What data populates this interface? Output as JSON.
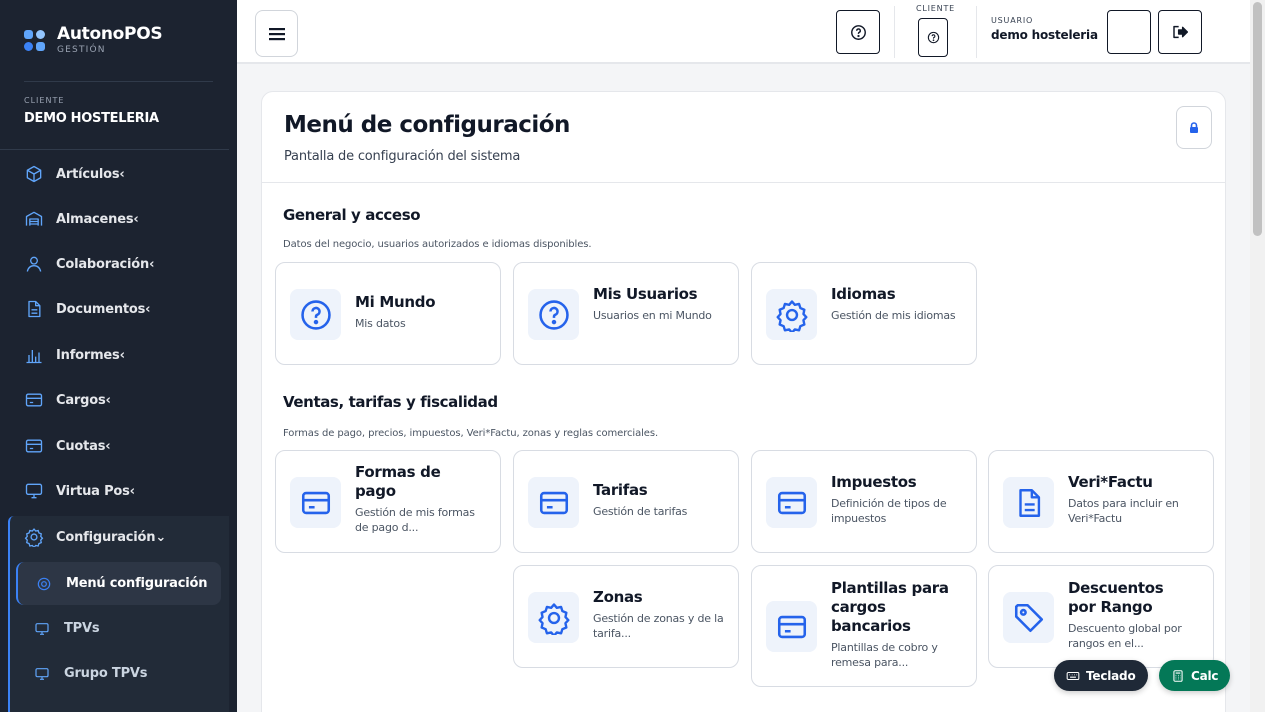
{
  "brand": {
    "name": "AutonoPOS",
    "subtitle": "GESTIÓN"
  },
  "client": {
    "label": "CLIENTE",
    "name": "DEMO HOSTELERIA"
  },
  "sidebar": {
    "items": [
      {
        "label": "Artículos‹",
        "icon": "cube-icon"
      },
      {
        "label": "Almacenes‹",
        "icon": "warehouse-icon"
      },
      {
        "label": "Colaboración‹",
        "icon": "user-icon"
      },
      {
        "label": "Documentos‹",
        "icon": "document-icon"
      },
      {
        "label": "Informes‹",
        "icon": "bar-chart-icon"
      },
      {
        "label": "Cargos‹",
        "icon": "card-icon"
      },
      {
        "label": "Cuotas‹",
        "icon": "card-icon"
      },
      {
        "label": "Virtua Pos‹",
        "icon": "monitor-icon"
      },
      {
        "label": "Configuración⌄",
        "icon": "gear-icon"
      }
    ],
    "submenu": [
      {
        "label": "Menú configuración",
        "icon": "gear-icon",
        "active": true
      },
      {
        "label": "TPVs",
        "icon": "monitor-icon"
      },
      {
        "label": "Grupo TPVs",
        "icon": "monitor-icon"
      }
    ]
  },
  "topbar": {
    "client_label": "CLIENTE",
    "user_label": "USUARIO",
    "user_name": "demo hosteleria"
  },
  "page": {
    "title": "Menú de configuración",
    "subtitle": "Pantalla de configuración del sistema"
  },
  "sections": [
    {
      "title": "General y acceso",
      "description": "Datos del negocio, usuarios autorizados e idiomas disponibles.",
      "tiles": [
        {
          "title": "Mi Mundo",
          "desc": "Mis datos",
          "icon": "question-circle-icon"
        },
        {
          "title": "Mis Usuarios",
          "desc": "Usuarios en mi Mundo",
          "icon": "question-circle-icon"
        },
        {
          "title": "Idiomas",
          "desc": "Gestión de mis idiomas",
          "icon": "gear-icon"
        }
      ]
    },
    {
      "title": "Ventas, tarifas y fiscalidad",
      "description": "Formas de pago, precios, impuestos, Veri*Factu, zonas y reglas comerciales.",
      "tiles": [
        {
          "title": "Formas de pago",
          "desc": "Gestión de mis formas de pago d...",
          "icon": "card-icon"
        },
        {
          "title": "Tarifas",
          "desc": "Gestión de tarifas",
          "icon": "card-icon"
        },
        {
          "title": "Impuestos",
          "desc": "Definición de tipos de impuestos",
          "icon": "card-icon"
        },
        {
          "title": "Veri*Factu",
          "desc": "Datos para incluir en Veri*Factu",
          "icon": "document-icon"
        },
        {
          "title": "Zonas",
          "desc": "Gestión de zonas y de la tarifa...",
          "icon": "gear-icon"
        },
        {
          "title": "Plantillas para cargos bancarios",
          "desc": "Plantillas de cobro y remesa para...",
          "icon": "card-icon"
        },
        {
          "title": "Descuentos por Rango",
          "desc": "Descuento global por rangos en el...",
          "icon": "tag-icon"
        }
      ]
    }
  ],
  "fabs": {
    "keyboard": {
      "label": "Teclado",
      "color": "#1f2937"
    },
    "calc": {
      "label": "Calc",
      "color": "#047857"
    }
  },
  "colors": {
    "accent": "#2563eb",
    "sidebar_bg": "#1c2330",
    "icon_bg": "#eef3fb"
  }
}
